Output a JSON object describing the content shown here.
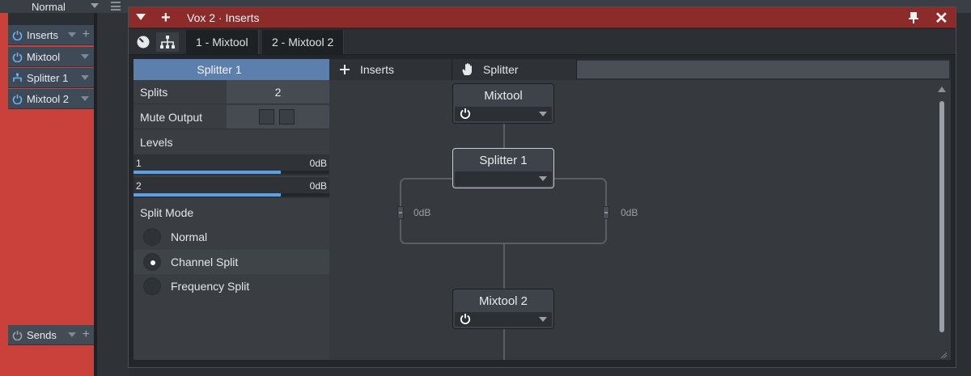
{
  "topbar": {
    "mode": "Normal"
  },
  "channel_strip": {
    "inserts_label": "Inserts",
    "items": [
      {
        "label": "Mixtool",
        "icon": "power-icon"
      },
      {
        "label": "Splitter 1",
        "icon": "splitter-icon"
      },
      {
        "label": "Mixtool 2",
        "icon": "power-icon"
      }
    ],
    "sends_label": "Sends"
  },
  "window": {
    "title": "Vox 2 · Inserts",
    "tabs": [
      "1 - Mixtool",
      "2 - Mixtool 2"
    ]
  },
  "left_panel": {
    "header": "Splitter 1",
    "splits_label": "Splits",
    "splits_value": "2",
    "mute_label": "Mute Output",
    "levels_label": "Levels",
    "levels": [
      {
        "num": "1",
        "db": "0dB",
        "fill": 0.75
      },
      {
        "num": "2",
        "db": "0dB",
        "fill": 0.75
      }
    ],
    "split_mode_label": "Split Mode",
    "split_modes": [
      "Normal",
      "Channel Split",
      "Frequency Split"
    ],
    "selected_mode": "Channel Split"
  },
  "routing": {
    "tabs": {
      "inserts": "Inserts",
      "splitter": "Splitter"
    },
    "nodes": {
      "top": "Mixtool",
      "middle": "Splitter 1",
      "bottom": "Mixtool 2"
    },
    "left_gain": "0dB",
    "right_gain": "0dB"
  },
  "colors": {
    "titlebar": "#8d2a2a",
    "channel_strip": "#c9413a",
    "selected_header": "#5d7fae",
    "level_fill": "#5aa1e6"
  }
}
